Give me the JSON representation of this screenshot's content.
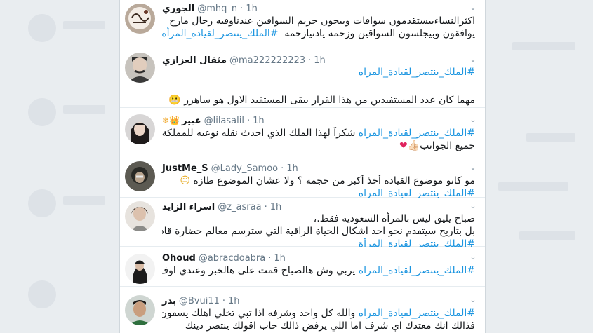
{
  "tweets": [
    {
      "name": "الجوري",
      "handle": "@mhq_n",
      "time": "1h",
      "lines": [
        {
          "text": "اكثرالنساءبيستقدمون سواقات وبيجون حريم السواقين عندناوفيه رجال مارح"
        },
        {
          "text": "يوافقون وبيجلسون السواقين وزحمه يادنيازحمه",
          "hashtag": "#الملك_ينتصر_لقيادة_المرأة"
        }
      ]
    },
    {
      "name": "مثقال العزازي",
      "handle": "@ma222222223",
      "time": "1h",
      "lines": [
        {
          "hashtag": "#الملك_ينتصر_لقيادة_المراه"
        },
        {
          "text": ""
        },
        {
          "text": "مهما كان عدد المستفيدين من هذا القرار يبقى المستفيد الاول هو ساهرر",
          "emoji": "😬"
        }
      ]
    },
    {
      "name": "عبير",
      "handle": "@lilasalil",
      "time": "1h",
      "name_emoji": "❄👑",
      "lines": [
        {
          "hashtag": "#الملك_ينتصر_لقيادة_المراه",
          "text": "شكراً لهذا الملك الذي احدث نقله نوعيه للمملكة في"
        },
        {
          "text": "جميع الجوانب",
          "emoji": "👍🏻❤"
        }
      ]
    },
    {
      "name": "JustMe_S",
      "handle": "@Lady_Samoo",
      "time": "1h",
      "lines": [
        {
          "text": "مو كانو موضوع القيادة أخذ أكبر من حجمه ؟ ولا عشان الموضوع طازه",
          "emoji": "😐"
        },
        {
          "hashtag": "#الملك_ينتصر_لقيادة_المراه"
        }
      ]
    },
    {
      "name": "اسراء الزايد",
      "handle": "@z_asraa",
      "time": "1h",
      "lines": [
        {
          "text": "صباح يليق ليس بالمرأة السعودية فقط.،"
        },
        {
          "text": "بل بتاريخ سيتقدم نحو احد اشكال الحياة الراقية التي سترسم معالم حضارة قادمة"
        },
        {
          "hashtag": "#الملك_ينتصر_لقيادة_المرأة"
        }
      ]
    },
    {
      "name": "Ohoud",
      "handle": "@abracdoabra",
      "time": "1h",
      "lines": [
        {
          "hashtag": "#الملك_ينتصر_لقيادة_المراه",
          "text": "يربي وش هالصباح قمت على هالخبر وعندي اوف"
        }
      ]
    },
    {
      "name": "بدر",
      "handle": "@Bvui11",
      "time": "1h",
      "lines": [
        {
          "hashtag": "#الملك_ينتصر_لقيادة_المراه",
          "text": "والله كل واحد وشرفه اذا تبي تخلي اهلك يسقون"
        },
        {
          "text": "فذالك انك معتدك اي شرف اما اللي يرفض ذالك حاب اقولك ينتصر دينك"
        }
      ]
    }
  ],
  "colors": {
    "hashtag": "#1b95e0",
    "meta": "#657786",
    "background": "#e6ecf0"
  },
  "icons": {
    "menu": "chevron-down-icon"
  }
}
